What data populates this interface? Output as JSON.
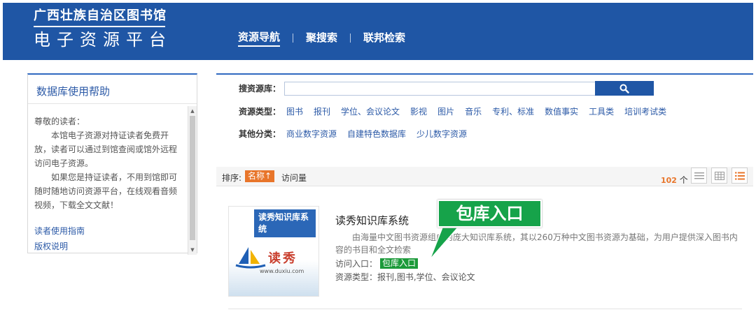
{
  "header": {
    "brand_line1": "广西壮族自治区图书馆",
    "brand_line2": "电子资源平台",
    "nav": [
      "资源导航",
      "聚搜索",
      "联邦检索"
    ]
  },
  "help": {
    "title": "数据库使用帮助",
    "greeting": "尊敬的读者：",
    "para1": "本馆电子资源对持证读者免费开放，读者可以通过到馆查阅或馆外远程访问电子资源。",
    "para2": "如果您是持证读者，不用到馆即可随时随地访问资源平台，在线观看音频视频，下载全文文献！",
    "links": [
      "读者使用指南",
      "版权说明"
    ]
  },
  "search": {
    "label": "搜资源库：",
    "value": "",
    "type_label": "资源类型：",
    "types": [
      "图书",
      "报刊",
      "学位、会议论文",
      "影视",
      "图片",
      "音乐",
      "专利、标准",
      "数值事实",
      "工具类",
      "培训考试类"
    ],
    "other_label": "其他分类：",
    "others": [
      "商业数字资源",
      "自建特色数据库",
      "少儿数字资源"
    ]
  },
  "results": {
    "sort_label": "排序:",
    "sort_active": "名称↑",
    "sort_visits": "访问量",
    "count": "102",
    "count_unit": "个"
  },
  "item": {
    "thumb_banner": "读秀知识库系统",
    "thumb_cn": "读秀",
    "thumb_url": "www.duxiu.com",
    "title": "读秀知识库系统",
    "description": "由海量中文图书资源组成的庞大知识库系统，其以260万种中文图书资源为基础，为用户提供深入图书内容的书目和全文检索",
    "access_label": "访问入口：",
    "access_badge": "包库入口",
    "type_text": "资源类型：报刊,图书,学位、会议论文"
  },
  "callout": {
    "label": "包库入口"
  },
  "colors": {
    "header": "#1f56a5",
    "accent_orange": "#e8752a",
    "badge_green": "#16a34a"
  }
}
